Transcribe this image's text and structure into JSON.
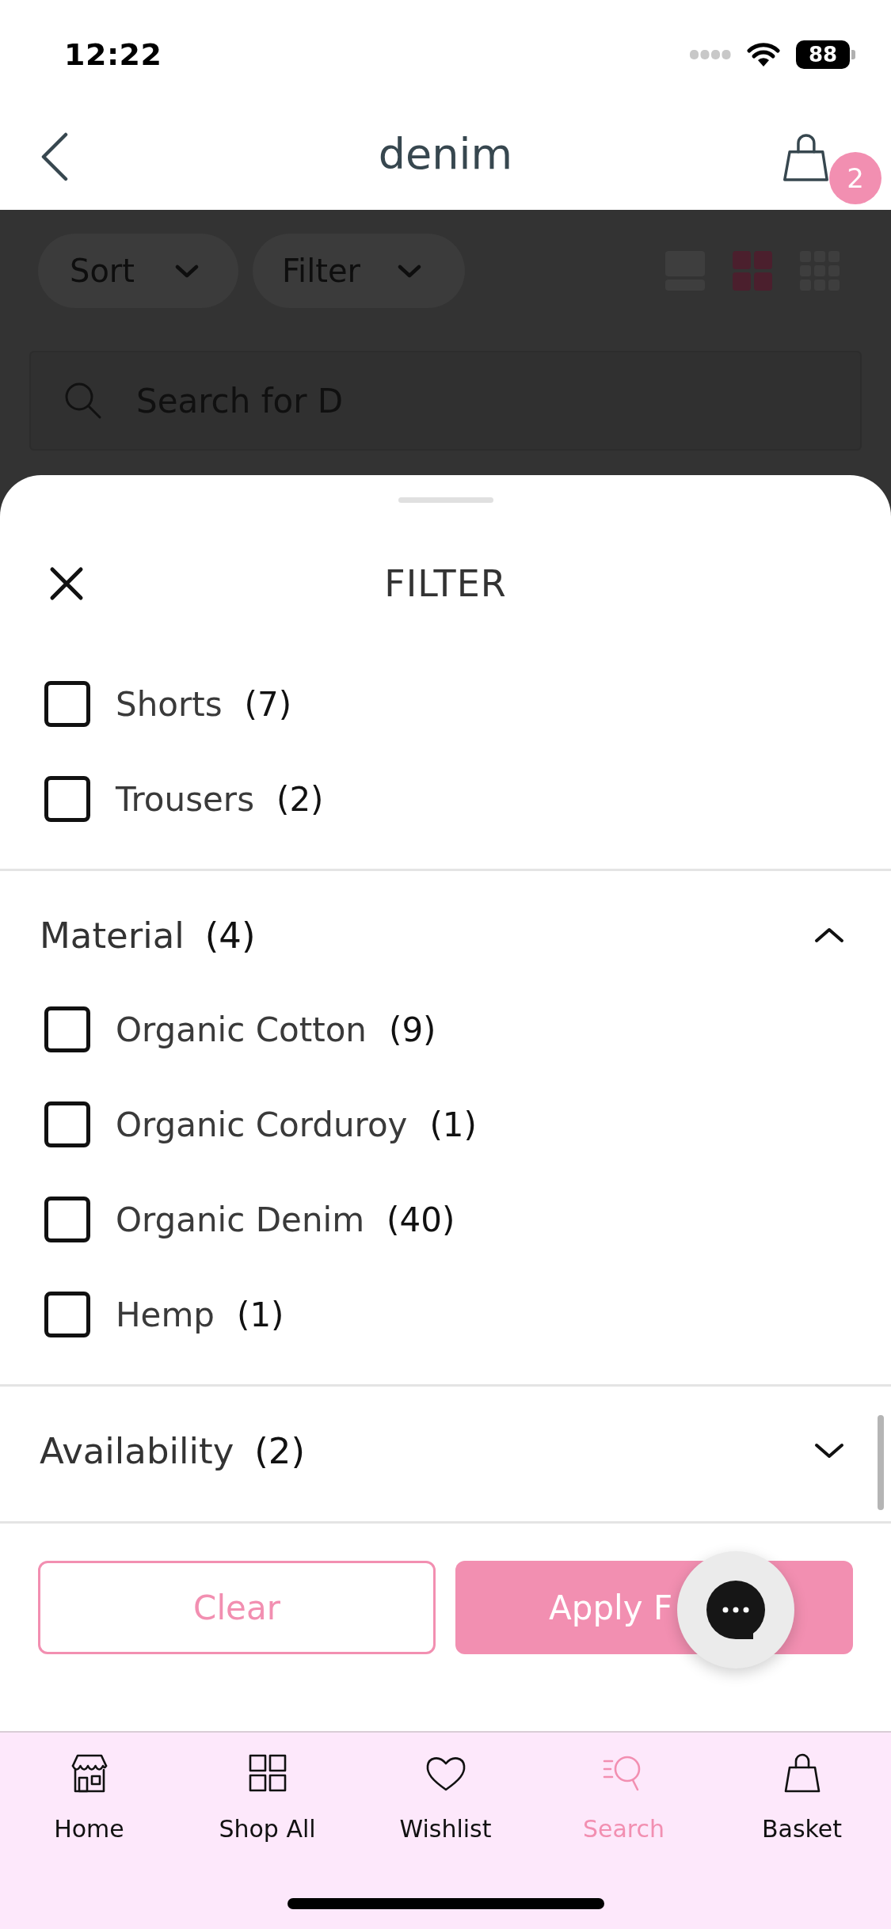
{
  "status_bar": {
    "time": "12:22",
    "battery": "88"
  },
  "header": {
    "title": "denim",
    "basket_count": "2"
  },
  "toolbar": {
    "buttons": [
      {
        "label": "Sort"
      },
      {
        "label": "Filter"
      }
    ],
    "view_options": [
      {
        "selected": false
      },
      {
        "selected": true
      },
      {
        "selected": false
      }
    ]
  },
  "search": {
    "value": "Search for D"
  },
  "filter_sheet": {
    "title": "FILTER",
    "sections": [
      {
        "options": [
          {
            "label": "Shorts",
            "count": "(7)",
            "checked": false
          },
          {
            "label": "Trousers",
            "count": "(2)",
            "checked": false
          }
        ]
      },
      {
        "title": "Material",
        "count": "(4)",
        "expanded": true,
        "options": [
          {
            "label": "Organic Cotton",
            "count": "(9)",
            "checked": false
          },
          {
            "label": "Organic Corduroy",
            "count": "(1)",
            "checked": false
          },
          {
            "label": "Organic Denim",
            "count": "(40)",
            "checked": false
          },
          {
            "label": "Hemp",
            "count": "(1)",
            "checked": false
          }
        ]
      },
      {
        "title": "Availability",
        "count": "(2)",
        "expanded": false
      }
    ],
    "clear_button": "Clear",
    "apply_button": "Apply F"
  },
  "tab_bar": {
    "items": [
      {
        "label": "Home",
        "selected": false
      },
      {
        "label": "Shop All",
        "selected": false
      },
      {
        "label": "Wishlist",
        "selected": false
      },
      {
        "label": "Search",
        "selected": true
      },
      {
        "label": "Basket",
        "selected": false
      }
    ]
  }
}
